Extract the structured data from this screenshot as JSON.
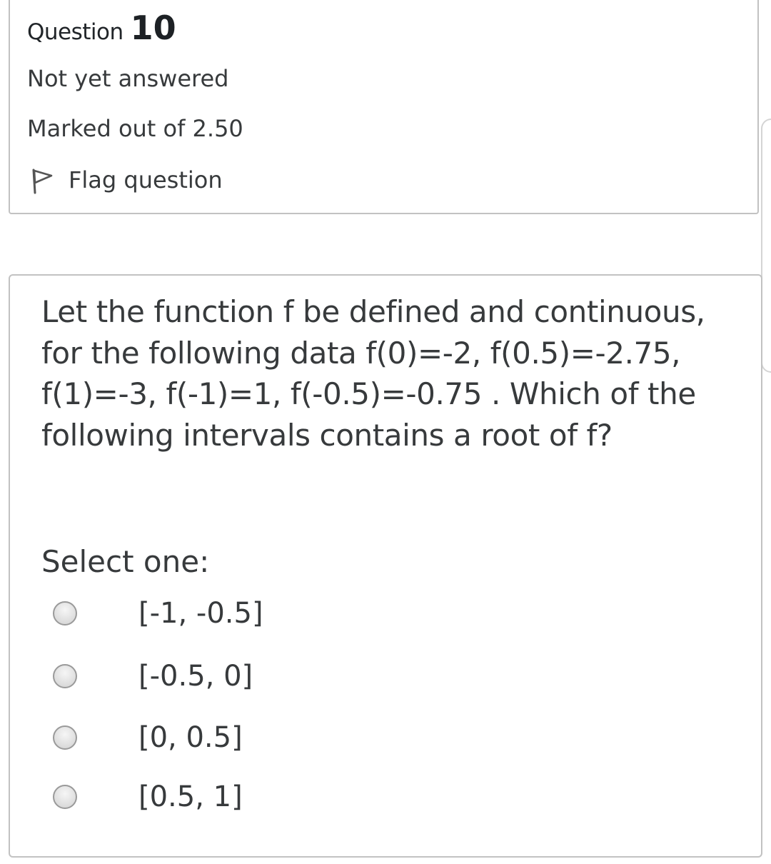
{
  "question_info": {
    "label": "Question",
    "number": "10",
    "state": "Not yet answered",
    "grade": "Marked out of 2.50",
    "flag_label": "Flag question",
    "flag_icon": "flag-icon"
  },
  "question": {
    "text": "Let the function f be defined and continuous, for the following data f(0)=-2, f(0.5)=-2.75, f(1)=-3, f(-1)=1, f(-0.5)=-0.75 . Which of the following intervals contains a root of f?",
    "prompt": "Select one:",
    "options": [
      {
        "label": "[-1, -0.5]",
        "selected": false
      },
      {
        "label": "[-0.5, 0]",
        "selected": false
      },
      {
        "label": "[0, 0.5]",
        "selected": false
      },
      {
        "label": "[0.5, 1]",
        "selected": false
      }
    ]
  },
  "colors": {
    "text": "#373a3c",
    "border": "#c2c2c2",
    "radio_fill": "#dcdcdc"
  }
}
